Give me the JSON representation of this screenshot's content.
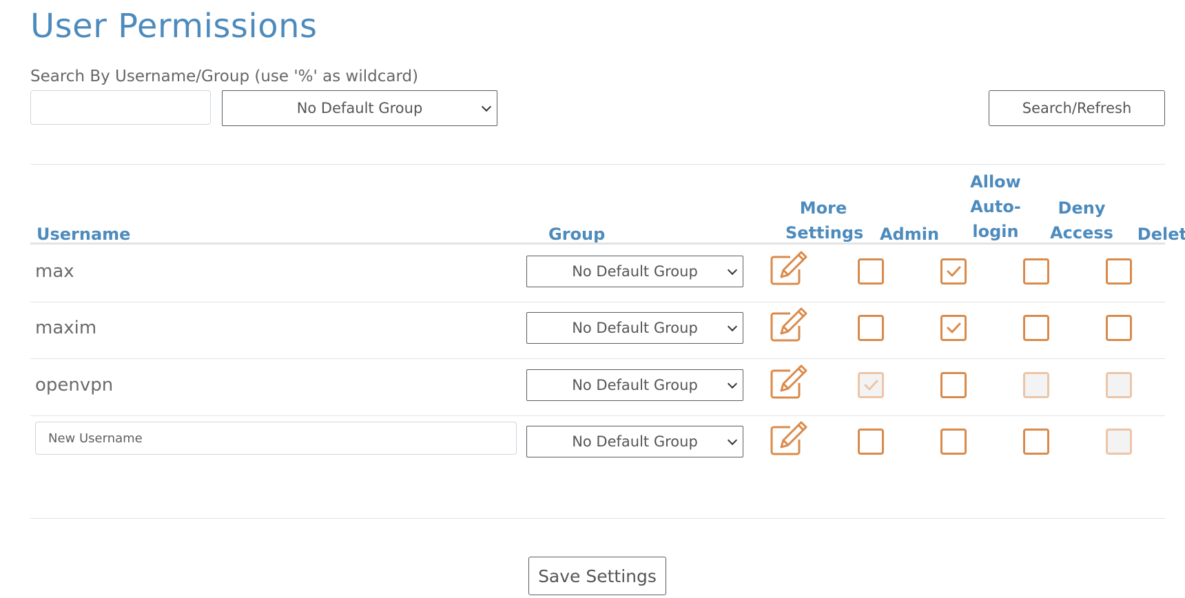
{
  "page": {
    "title": "User Permissions",
    "accent_color": "#4d8bbd",
    "checkbox_color": "#d98a4a"
  },
  "search": {
    "label": "Search By Username/Group (use '%' as wildcard)",
    "username_value": "",
    "group_selected": "No Default Group",
    "refresh_label": "Search/Refresh"
  },
  "table": {
    "headers": {
      "username": "Username",
      "group": "Group",
      "more_settings_1": "More",
      "more_settings_2": "Settings",
      "admin": "Admin",
      "autologin_1": "Allow",
      "autologin_2": "Auto-",
      "autologin_3": "login",
      "deny_1": "Deny",
      "deny_2": "Access",
      "delete": "Delete"
    },
    "rows": [
      {
        "username": "max",
        "group": "No Default Group",
        "edit_icon": "pencil-edit-icon",
        "admin": false,
        "admin_disabled": false,
        "autologin": true,
        "autologin_disabled": false,
        "deny": false,
        "deny_disabled": false,
        "delete": false,
        "delete_disabled": false
      },
      {
        "username": "maxim",
        "group": "No Default Group",
        "edit_icon": "pencil-edit-icon",
        "admin": false,
        "admin_disabled": false,
        "autologin": true,
        "autologin_disabled": false,
        "deny": false,
        "deny_disabled": false,
        "delete": false,
        "delete_disabled": false
      },
      {
        "username": "openvpn",
        "group": "No Default Group",
        "edit_icon": "pencil-edit-icon",
        "admin": true,
        "admin_disabled": true,
        "autologin": false,
        "autologin_disabled": false,
        "deny": false,
        "deny_disabled": true,
        "delete": false,
        "delete_disabled": true
      }
    ],
    "new_row": {
      "username_placeholder": "New Username",
      "group": "No Default Group",
      "edit_icon": "pencil-edit-icon",
      "admin": false,
      "autologin": false,
      "deny": false,
      "delete": false,
      "delete_disabled": true
    }
  },
  "save_label": "Save Settings"
}
